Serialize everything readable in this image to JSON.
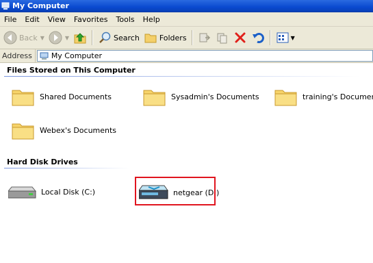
{
  "window": {
    "title": "My Computer"
  },
  "menu": [
    "File",
    "Edit",
    "View",
    "Favorites",
    "Tools",
    "Help"
  ],
  "toolbar": {
    "back_label": "Back",
    "search_label": "Search",
    "folders_label": "Folders"
  },
  "address": {
    "label": "Address",
    "value": "My Computer"
  },
  "groups": {
    "files": {
      "title": "Files Stored on This Computer",
      "items": [
        "Shared Documents",
        "Sysadmin's Documents",
        "training's Documents",
        "Webex's Documents"
      ]
    },
    "drives": {
      "title": "Hard Disk Drives",
      "items": [
        "Local Disk (C:)",
        "netgear (D:)"
      ]
    }
  },
  "colors": {
    "titlebar": "#0a4ad0",
    "highlight": "#e0141e",
    "folder": "#f7d46b"
  }
}
